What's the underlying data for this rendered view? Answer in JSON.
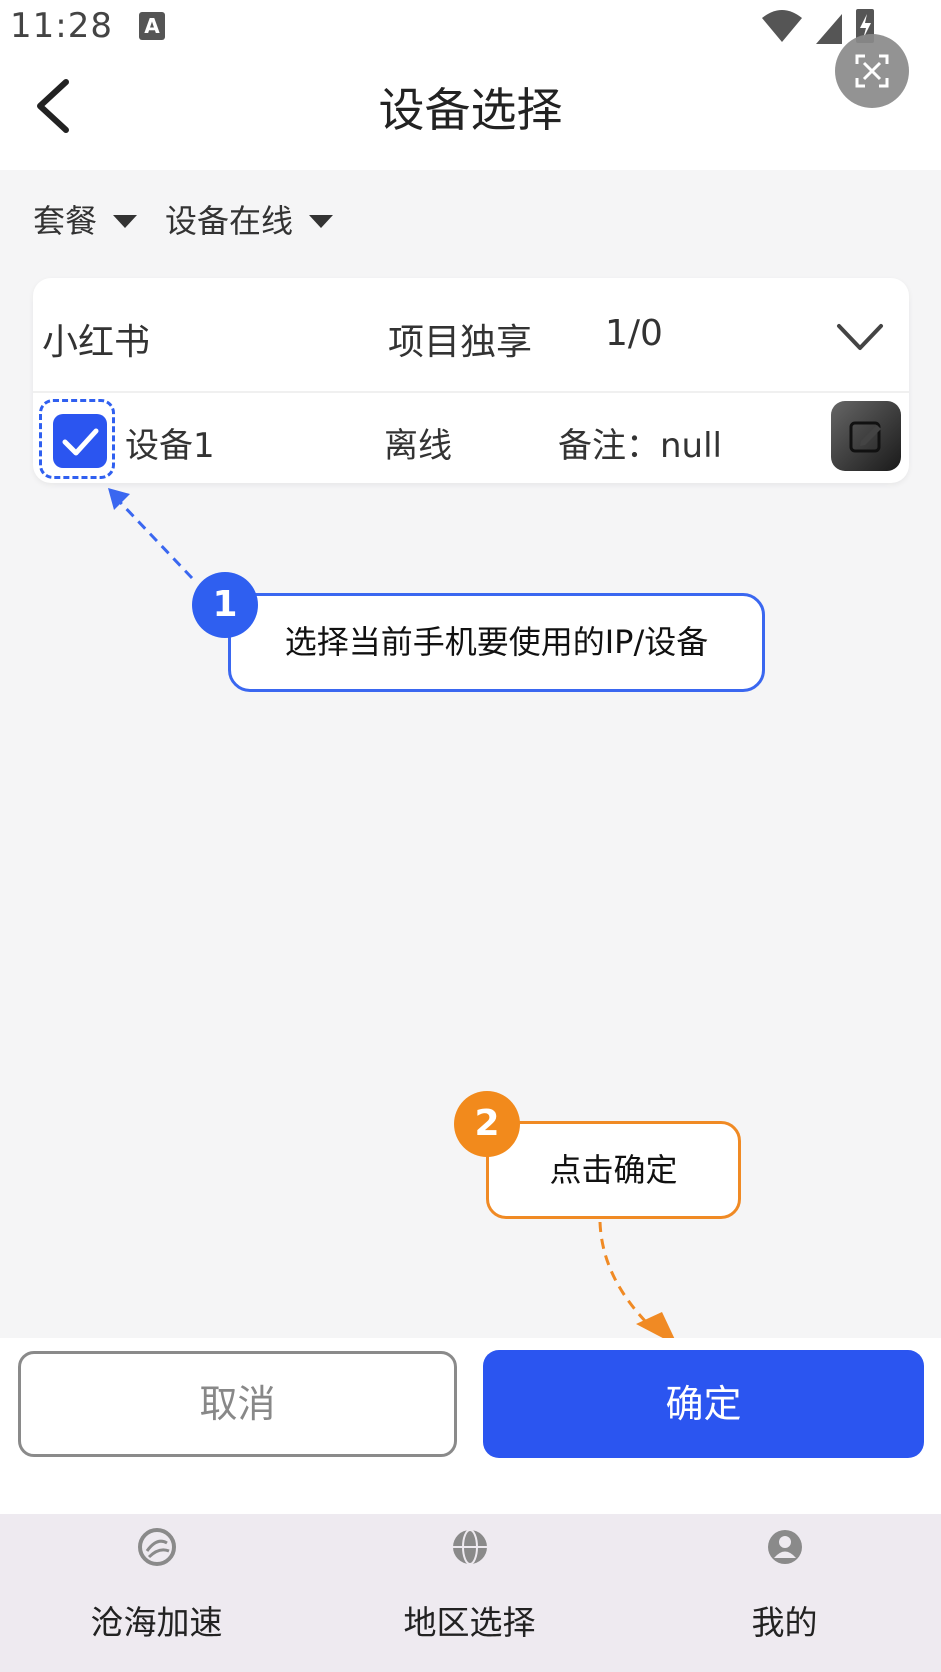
{
  "status_bar": {
    "time": "11:28",
    "notification_icon": "A"
  },
  "header": {
    "title": "设备选择",
    "back_icon": "chevron-left-icon",
    "screenshot_icon": "screenshot-frame-icon"
  },
  "filters": [
    {
      "label": "套餐"
    },
    {
      "label": "设备在线"
    }
  ],
  "group": {
    "app_name": "小红书",
    "mode": "项目独享",
    "count": "1/0",
    "expand_icon": "chevron-down-icon"
  },
  "device": {
    "checked": true,
    "name": "设备1",
    "status": "离线",
    "remark": "备注：null",
    "edit_icon": "edit-icon"
  },
  "callouts": [
    {
      "badge": "1",
      "text": "选择当前手机要使用的IP/设备",
      "color": "#2f5ff0"
    },
    {
      "badge": "2",
      "text": "点击确定",
      "color": "#f28a1c"
    }
  ],
  "actions": {
    "cancel": "取消",
    "confirm": "确定"
  },
  "tabs": [
    {
      "label": "沧海加速",
      "icon": "speed-logo-icon"
    },
    {
      "label": "地区选择",
      "icon": "globe-icon"
    },
    {
      "label": "我的",
      "icon": "user-icon"
    }
  ],
  "colors": {
    "primary": "#2b55f0",
    "accent_orange": "#f28a1c",
    "background": "#f5f5f6",
    "tabbar": "#eeeaf0"
  }
}
